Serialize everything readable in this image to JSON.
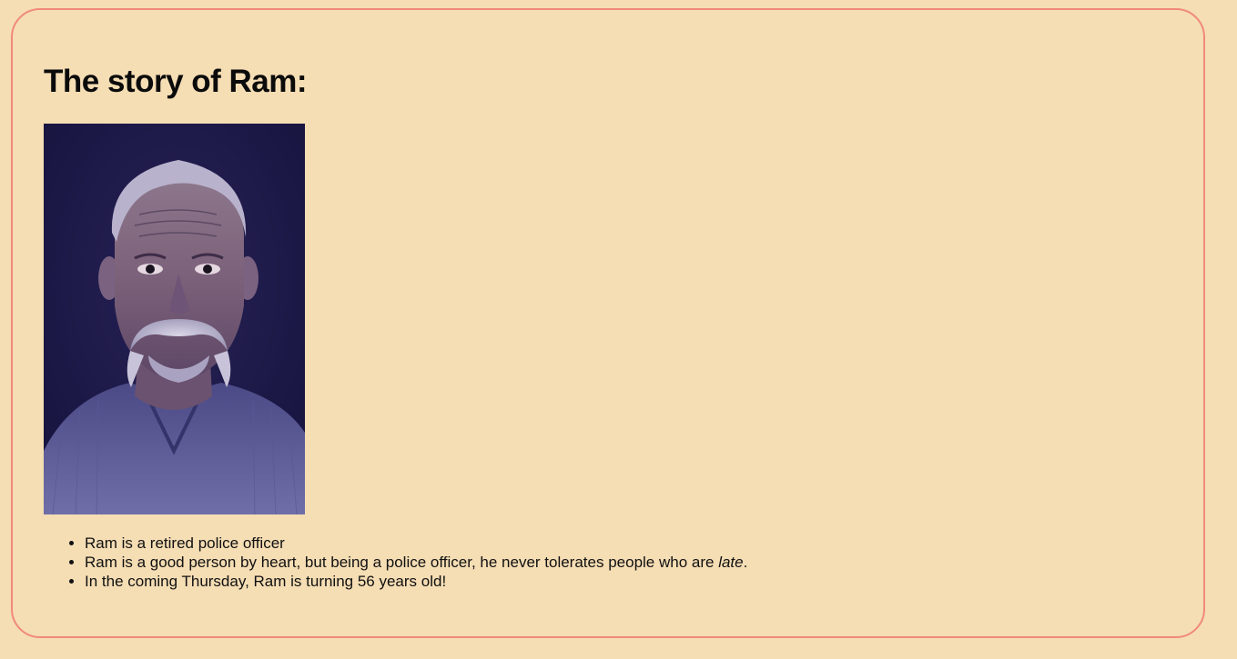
{
  "page": {
    "background_color": "#f5ddb4",
    "card_border_color": "#f08a7a",
    "title": "The story of Ram:"
  },
  "portrait": {
    "description": "portrait-photo",
    "background_color": "#1e1a4e"
  },
  "facts": [
    {
      "text": "Ram is a retired police officer"
    },
    {
      "before": "Ram is a good person by heart, but being a police officer, he never tolerates people who are ",
      "emphasis": "late",
      "after": "."
    },
    {
      "text": "In the coming Thursday, Ram is turning 56 years old!"
    }
  ]
}
